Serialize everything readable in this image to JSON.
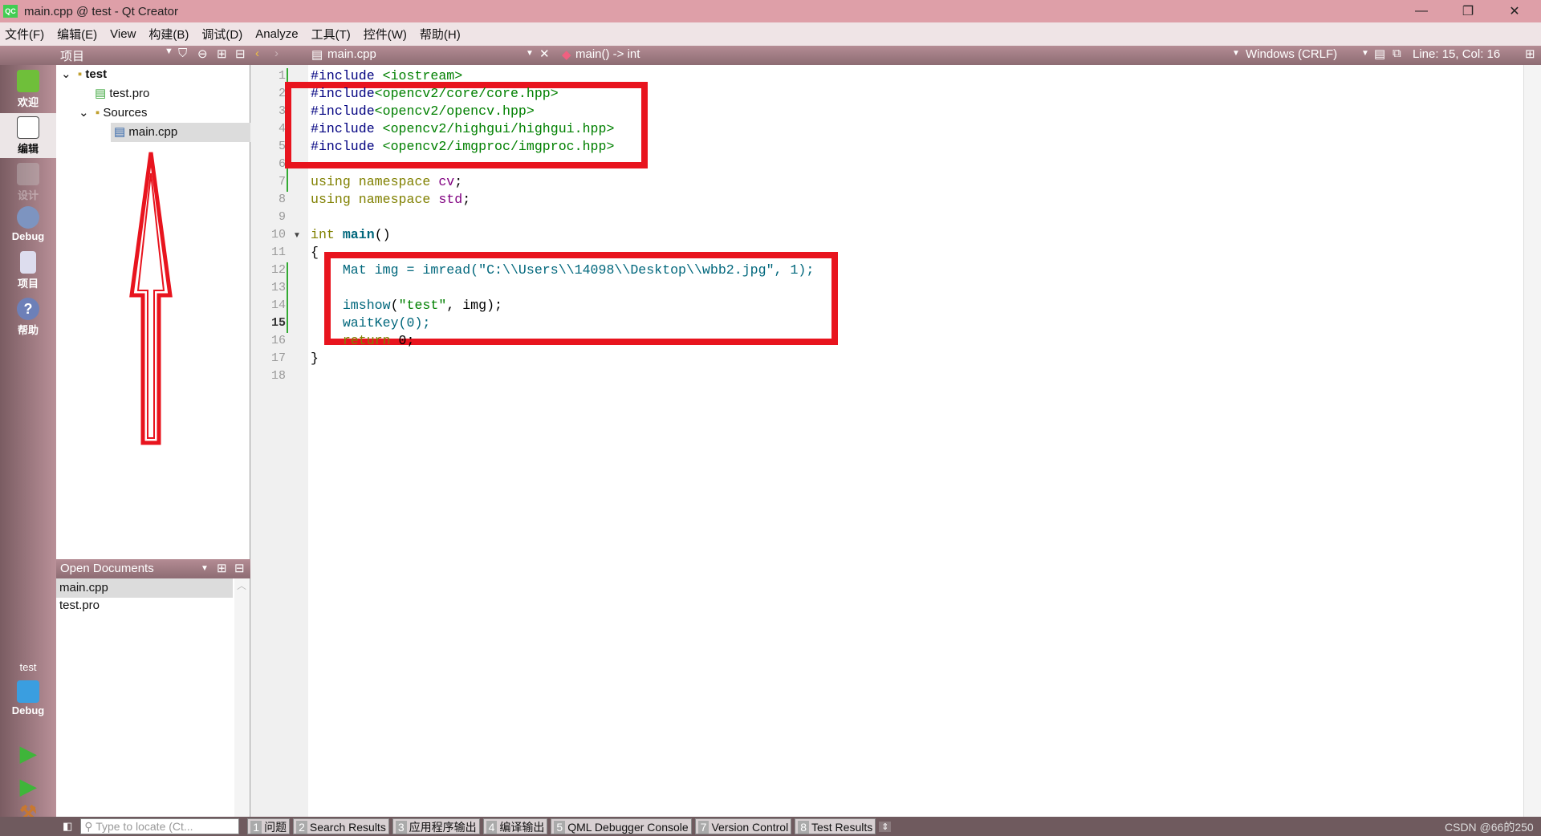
{
  "window": {
    "title": "main.cpp @ test - Qt Creator",
    "icon": "qt-creator-logo",
    "logo_text": "QC"
  },
  "menu": [
    "文件(F)",
    "编辑(E)",
    "View",
    "构建(B)",
    "调试(D)",
    "Analyze",
    "工具(T)",
    "控件(W)",
    "帮助(H)"
  ],
  "project_pane": {
    "title": "项目",
    "tree": [
      {
        "label": "test",
        "level": 0
      },
      {
        "label": "test.pro",
        "level": 1
      },
      {
        "label": "Sources",
        "level": 1
      },
      {
        "label": "main.cpp",
        "level": 2,
        "selected": true
      }
    ]
  },
  "editor_toolbar": {
    "file": "main.cpp",
    "symbol": "main() -> int",
    "line_ending": "Windows (CRLF)",
    "cursor": "Line: 15, Col: 16"
  },
  "modes": [
    {
      "label": "欢迎"
    },
    {
      "label": "编辑",
      "active": true
    },
    {
      "label": "设计",
      "disabled": true
    },
    {
      "label": "Debug"
    },
    {
      "label": "项目"
    },
    {
      "label": "帮助"
    }
  ],
  "kit": {
    "project": "test",
    "config": "Debug"
  },
  "open_documents": {
    "title": "Open Documents",
    "items": [
      "main.cpp",
      "test.pro"
    ]
  },
  "code": [
    "#include <iostream>",
    "#include<opencv2/core/core.hpp>",
    "#include<opencv2/opencv.hpp>",
    "#include <opencv2/highgui/highgui.hpp>",
    "#include <opencv2/imgproc/imgproc.hpp>",
    "",
    "using namespace cv;",
    "using namespace std;",
    "",
    "int main()",
    "{",
    "    Mat img = imread(\"C:\\\\Users\\\\14098\\\\Desktop\\\\wbb2.jpg\", 1);",
    "",
    "    imshow(\"test\", img);",
    "    waitKey(0);",
    "    return 0;",
    "}",
    ""
  ],
  "current_line": 15,
  "bottom": {
    "locator_placeholder": "Type to locate (Ct...",
    "tabs": [
      {
        "n": "1",
        "label": "问题"
      },
      {
        "n": "2",
        "label": "Search Results"
      },
      {
        "n": "3",
        "label": "应用程序输出"
      },
      {
        "n": "4",
        "label": "编译输出"
      },
      {
        "n": "5",
        "label": "QML Debugger Console"
      },
      {
        "n": "7",
        "label": "Version Control"
      },
      {
        "n": "8",
        "label": "Test Results"
      }
    ]
  },
  "watermark": "CSDN @66的250",
  "annotation_color": "#e8141e"
}
